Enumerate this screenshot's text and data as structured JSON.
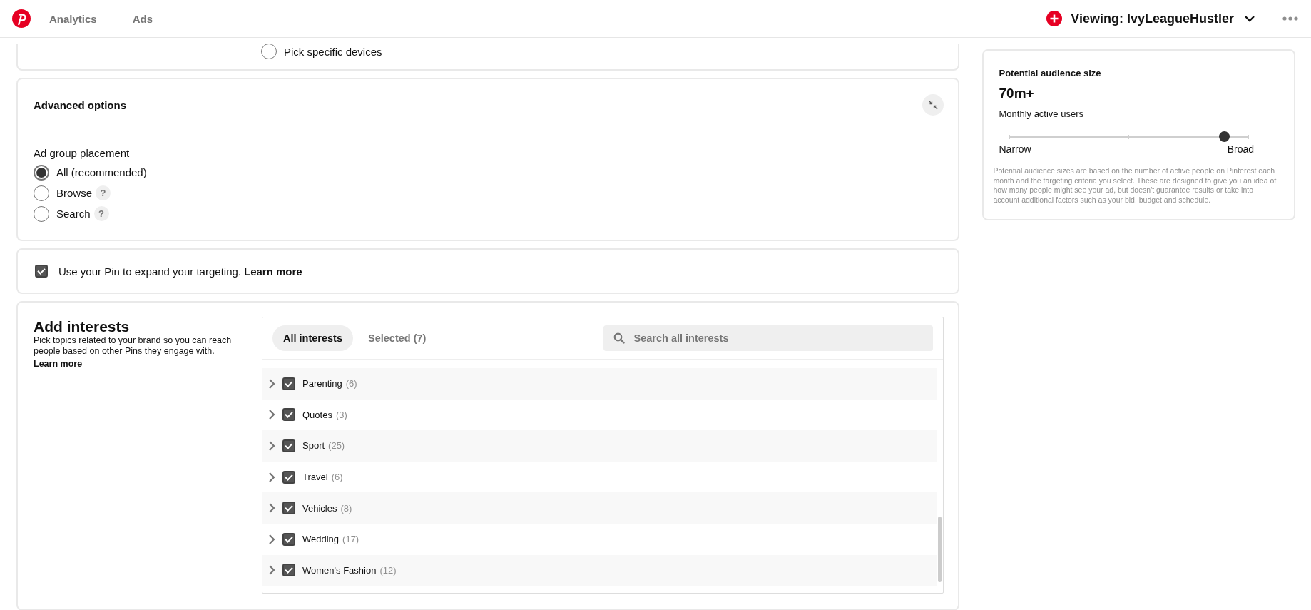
{
  "nav": {
    "links": [
      {
        "label": "Analytics"
      },
      {
        "label": "Ads"
      }
    ],
    "account": "Viewing: IvyLeagueHustler"
  },
  "devices": {
    "options": [
      {
        "label": "Pick specific devices",
        "selected": false
      }
    ]
  },
  "advanced": {
    "title": "Advanced options",
    "placement_label": "Ad group placement",
    "options": [
      {
        "label": "All (recommended)",
        "selected": true
      },
      {
        "label": "Browse",
        "selected": false,
        "help": "?"
      },
      {
        "label": "Search",
        "selected": false,
        "help": "?"
      }
    ]
  },
  "expand": {
    "checked": true,
    "text": "Use your Pin to expand your targeting.",
    "link": "Learn more"
  },
  "interests": {
    "title": "Add interests",
    "description": "Pick topics related to your brand so you can reach people based on other Pins they engage with.",
    "learn_more": "Learn more",
    "tabs": [
      {
        "label": "All interests",
        "selected": true
      },
      {
        "label": "Selected (7)",
        "selected": false
      }
    ],
    "search": {
      "placeholder": "Search all interests"
    },
    "rows": [
      {
        "name": "Parenting",
        "count": "(6)",
        "checked": true,
        "expanded": false
      },
      {
        "name": "Quotes",
        "count": "(3)",
        "checked": true,
        "expanded": false
      },
      {
        "name": "Sport",
        "count": "(25)",
        "checked": true,
        "expanded": false
      },
      {
        "name": "Travel",
        "count": "(6)",
        "checked": true,
        "expanded": false
      },
      {
        "name": "Vehicles",
        "count": "(8)",
        "checked": true,
        "expanded": false
      },
      {
        "name": "Wedding",
        "count": "(17)",
        "checked": true,
        "expanded": false
      },
      {
        "name": "Women's Fashion",
        "count": "(12)",
        "checked": true,
        "expanded": false
      }
    ]
  },
  "audience": {
    "title": "Potential audience size",
    "value": "70m+",
    "unit": "Monthly active users",
    "level": 0.9,
    "min_label": "Narrow",
    "max_label": "Broad",
    "note": "Potential audience sizes are based on the number of active people on Pinterest each month and the targeting criteria you select. These are designed to give you an idea of how many people might see your ad, but doesn't guarantee results or take into account additional factors such as your bid, budget and schedule."
  }
}
